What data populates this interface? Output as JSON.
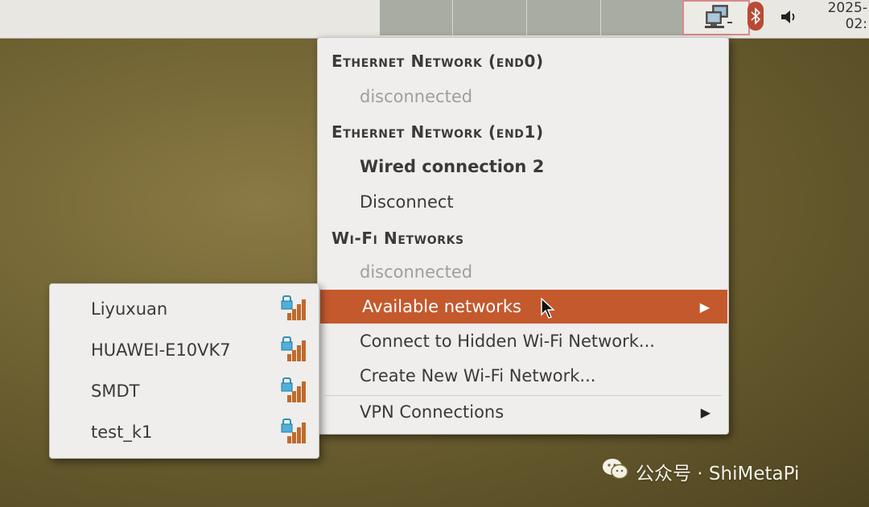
{
  "panel": {
    "clock_line1": "2025-",
    "clock_line2": "02:"
  },
  "network_menu": {
    "ethernet0": {
      "header": "Ethernet Network (end0)",
      "status": "disconnected"
    },
    "ethernet1": {
      "header": "Ethernet Network (end1)",
      "connection": "Wired connection 2",
      "disconnect_label": "Disconnect"
    },
    "wifi": {
      "header": "Wi-Fi Networks",
      "status": "disconnected",
      "available_label": "Available networks",
      "hidden_label": "Connect to Hidden Wi-Fi Network...",
      "create_label": "Create New Wi-Fi Network..."
    },
    "vpn_label": "VPN Connections"
  },
  "available_networks": [
    {
      "ssid": "Liyuxuan",
      "secured": true
    },
    {
      "ssid": "HUAWEI-E10VK7",
      "secured": true
    },
    {
      "ssid": "SMDT",
      "secured": true
    },
    {
      "ssid": "test_k1",
      "secured": true
    }
  ],
  "watermark": {
    "text": "公众号 · ShiMetaPi"
  },
  "colors": {
    "highlight": "#c4592d",
    "menu_bg": "#efeeec",
    "desktop": "#6e6132"
  },
  "icons": [
    "network-tray-icon",
    "bluetooth-icon",
    "volume-icon",
    "submenu-arrow-icon",
    "mouse-cursor-icon",
    "wifi-signal-locked-icon",
    "wechat-icon"
  ]
}
